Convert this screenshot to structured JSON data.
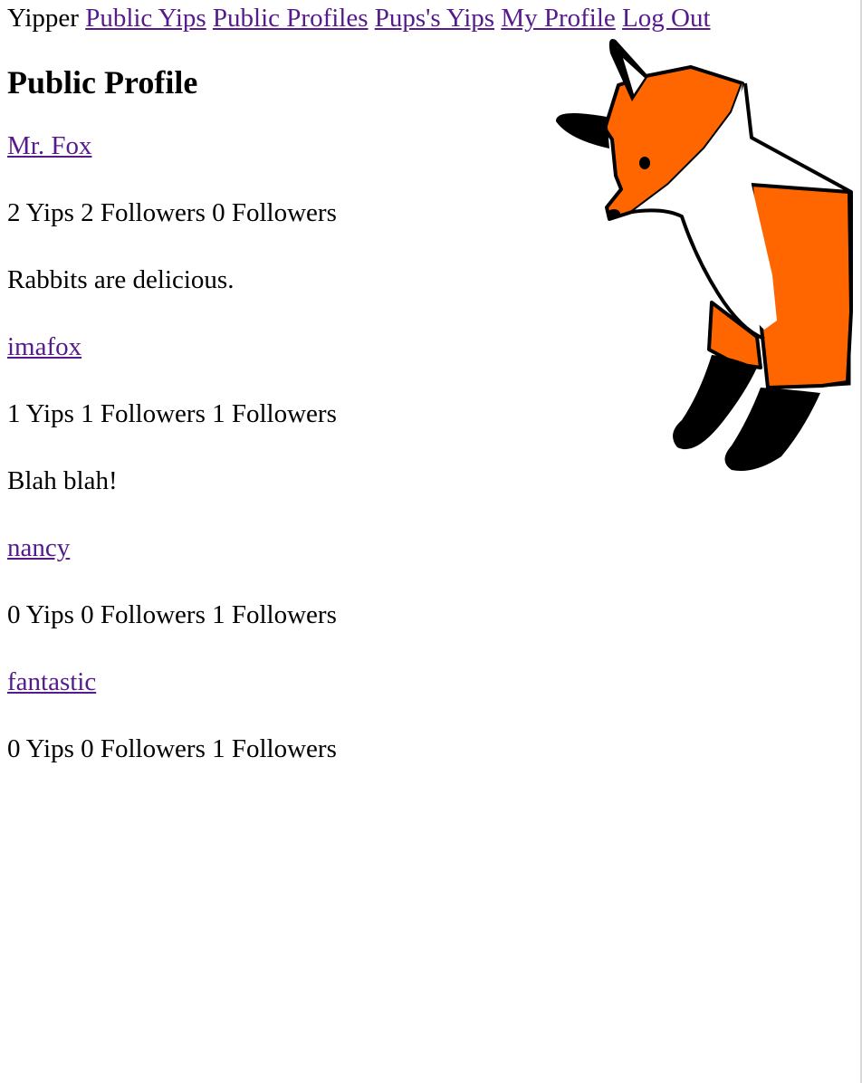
{
  "nav": {
    "brand": "Yipper",
    "links": [
      {
        "label": "Public Yips"
      },
      {
        "label": "Public Profiles"
      },
      {
        "label": "Pups's Yips"
      },
      {
        "label": "My Profile"
      },
      {
        "label": "Log Out"
      }
    ]
  },
  "page": {
    "title": "Public Profile"
  },
  "profiles": [
    {
      "name": "Mr. Fox",
      "yips": "2 Yips",
      "followers": "2 Followers",
      "following": "0 Followers",
      "bio": "Rabbits are delicious."
    },
    {
      "name": "imafox",
      "yips": "1 Yips",
      "followers": "1 Followers",
      "following": "1 Followers",
      "bio": "Blah blah!"
    },
    {
      "name": "nancy",
      "yips": "0 Yips",
      "followers": "0 Followers",
      "following": "1 Followers",
      "bio": ""
    },
    {
      "name": "fantastic",
      "yips": "0 Yips",
      "followers": "0 Followers",
      "following": "1 Followers",
      "bio": ""
    }
  ],
  "colors": {
    "link": "#551a8b",
    "fox_orange": "#ff6600",
    "fox_black": "#000000",
    "fox_white": "#ffffff"
  },
  "icons": {
    "mascot": "fox-mascot-illustration"
  }
}
